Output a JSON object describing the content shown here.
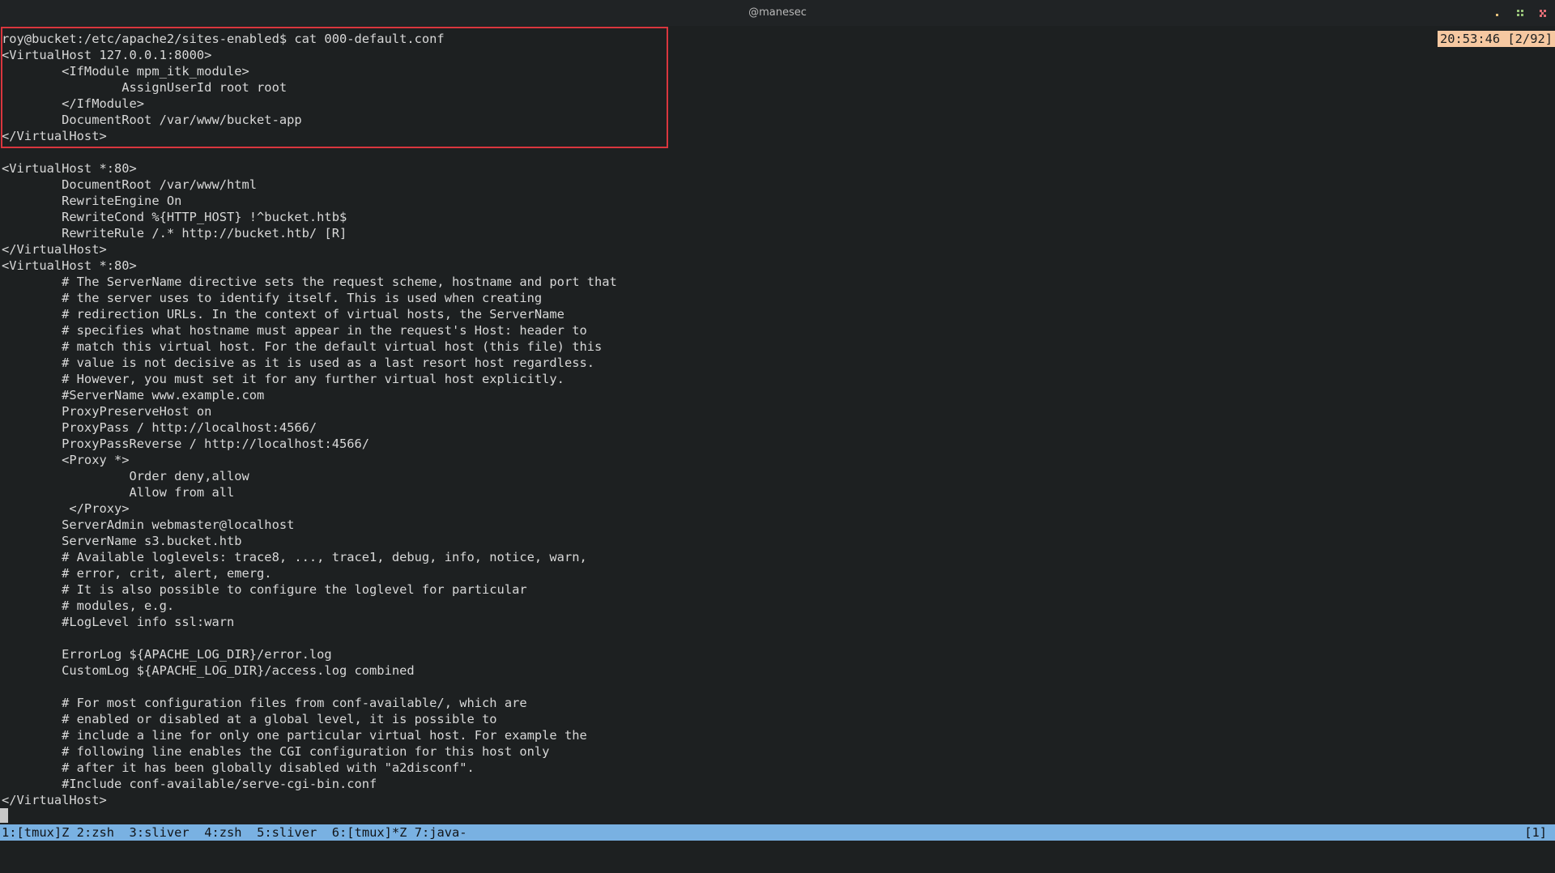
{
  "titlebar": {
    "title": "@manesec"
  },
  "terminal": {
    "lines": [
      "roy@bucket:/etc/apache2/sites-enabled$ cat 000-default.conf",
      "<VirtualHost 127.0.0.1:8000>",
      "        <IfModule mpm_itk_module>",
      "                AssignUserId root root",
      "        </IfModule>",
      "        DocumentRoot /var/www/bucket-app",
      "</VirtualHost>",
      "",
      "<VirtualHost *:80>",
      "        DocumentRoot /var/www/html",
      "        RewriteEngine On",
      "        RewriteCond %{HTTP_HOST} !^bucket.htb$",
      "        RewriteRule /.* http://bucket.htb/ [R]",
      "</VirtualHost>",
      "<VirtualHost *:80>",
      "        # The ServerName directive sets the request scheme, hostname and port that",
      "        # the server uses to identify itself. This is used when creating",
      "        # redirection URLs. In the context of virtual hosts, the ServerName",
      "        # specifies what hostname must appear in the request's Host: header to",
      "        # match this virtual host. For the default virtual host (this file) this",
      "        # value is not decisive as it is used as a last resort host regardless.",
      "        # However, you must set it for any further virtual host explicitly.",
      "        #ServerName www.example.com",
      "        ProxyPreserveHost on",
      "        ProxyPass / http://localhost:4566/",
      "        ProxyPassReverse / http://localhost:4566/",
      "        <Proxy *>",
      "                 Order deny,allow",
      "                 Allow from all",
      "         </Proxy>",
      "        ServerAdmin webmaster@localhost",
      "        ServerName s3.bucket.htb",
      "        # Available loglevels: trace8, ..., trace1, debug, info, notice, warn,",
      "        # error, crit, alert, emerg.",
      "        # It is also possible to configure the loglevel for particular",
      "        # modules, e.g.",
      "        #LogLevel info ssl:warn",
      "",
      "        ErrorLog ${APACHE_LOG_DIR}/error.log",
      "        CustomLog ${APACHE_LOG_DIR}/access.log combined",
      "",
      "        # For most configuration files from conf-available/, which are",
      "        # enabled or disabled at a global level, it is possible to",
      "        # include a line for only one particular virtual host. For example the",
      "        # following line enables the CGI configuration for this host only",
      "        # after it has been globally disabled with \"a2disconf\".",
      "        #Include conf-available/serve-cgi-bin.conf",
      "</VirtualHost>"
    ]
  },
  "clock": "20:53:46 [2/92]",
  "statusbar": {
    "windows": [
      "1:[tmux]Z ",
      "2:zsh  ",
      "3:sliver  ",
      "4:zsh  ",
      "5:sliver  ",
      "6:[tmux]*Z ",
      "7:java-"
    ],
    "session": "[1]"
  },
  "colors": {
    "background": "#1d2021",
    "statusbar": "#79b1e2",
    "clock_bg": "#f6c8a1",
    "highlight_border": "#d9363e"
  },
  "icons": [
    "minimize-icon",
    "maximize-icon",
    "close-icon"
  ]
}
